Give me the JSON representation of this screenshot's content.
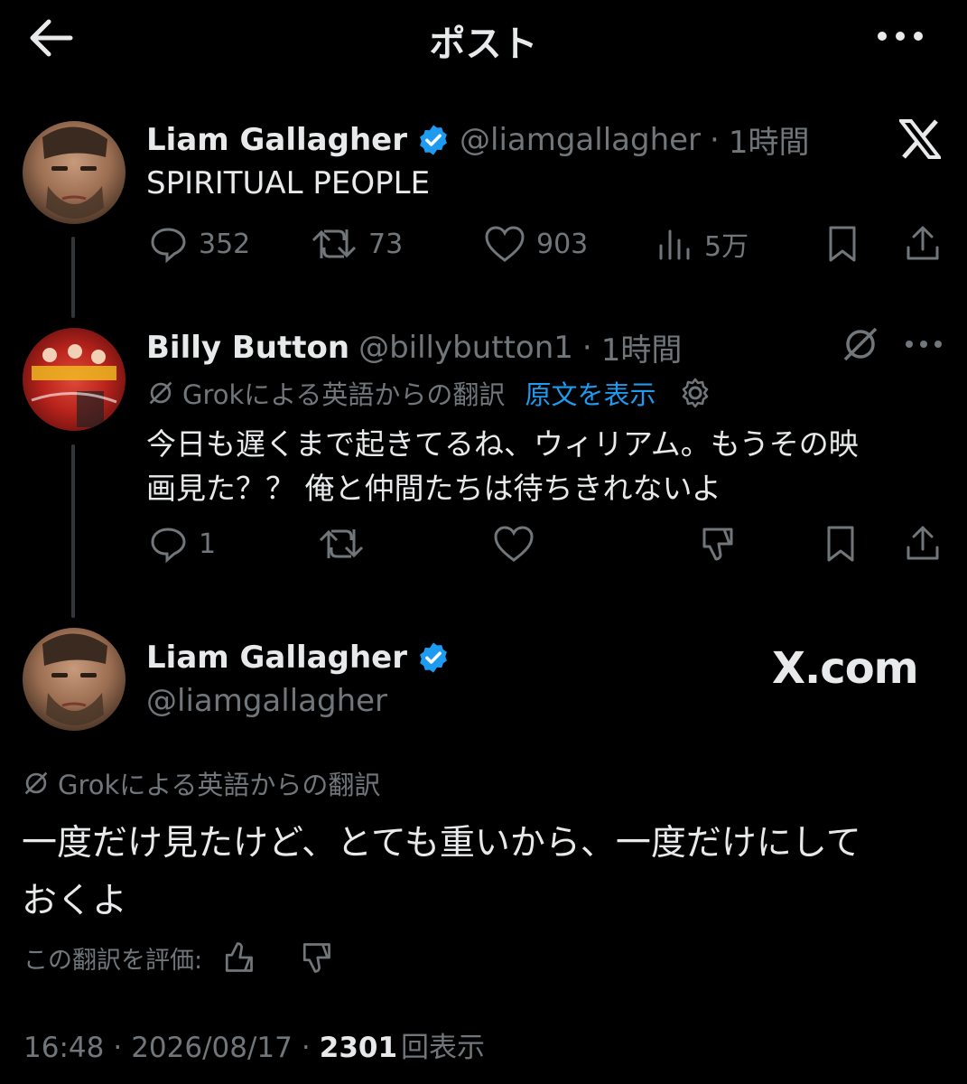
{
  "header": {
    "title": "ポスト"
  },
  "post1": {
    "author_name": "Liam Gallagher",
    "handle": "@liamgallagher",
    "time": "1時間",
    "text": "SPIRITUAL PEOPLE",
    "replies": "352",
    "reposts": "73",
    "likes": "903",
    "views": "5万"
  },
  "post2": {
    "author_name": "Billy Button",
    "handle": "@billybutton1",
    "time": "1時間",
    "translation_label": "Grokによる英語からの翻訳",
    "show_original": "原文を表示",
    "text_line1": "今日も遅くまで起きてるね、ウィリアム。もうその映",
    "text_line2": "画見た？？ 俺と仲間たちは待ちきれないよ",
    "replies": "1"
  },
  "main_post": {
    "author_name": "Liam Gallagher",
    "handle": "@liamgallagher",
    "watermark": "X.com",
    "translation_label": "Grokによる英語からの翻訳",
    "text_line1": "一度だけ見たけど、とても重いから、一度だけにして",
    "text_line2": "おくよ",
    "rate_label": "この翻訳を評価:",
    "timestamp": "16:48",
    "date": "2026/08/17",
    "view_count": "2301",
    "view_label": "回表示"
  },
  "colors": {
    "background": "#000000",
    "text": "#e7e9ea",
    "secondary": "#71767b",
    "link": "#1d9bf0",
    "verified": "#1d9bf0"
  },
  "icons": [
    "back-arrow-icon",
    "more-icon",
    "x-logo-icon",
    "verified-badge-icon",
    "reply-icon",
    "repost-icon",
    "like-icon",
    "views-icon",
    "bookmark-icon",
    "share-icon",
    "grok-icon",
    "settings-gear-icon",
    "thumbs-up-icon",
    "thumbs-down-icon"
  ]
}
